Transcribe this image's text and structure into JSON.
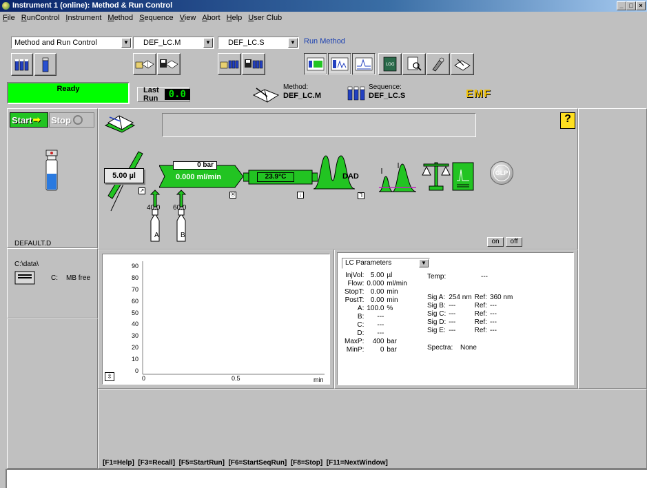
{
  "window": {
    "title": "Instrument 1 (online): Method & Run Control",
    "minimize": "_",
    "maximize": "□",
    "close": "×"
  },
  "menu": [
    "File",
    "RunControl",
    "Instrument",
    "Method",
    "Sequence",
    "View",
    "Abort",
    "Help",
    "User Club"
  ],
  "toolbar": {
    "view_select": "Method and Run Control",
    "method_select": "DEF_LC.M",
    "sequence_select": "DEF_LC.S",
    "run_method_link": "Run Method"
  },
  "status": {
    "state": "Ready",
    "state_color": "#00ff00",
    "last_run_label": "Last Run",
    "last_run_value": "0.0",
    "method_label": "Method:",
    "method_value": "DEF_LC.M",
    "sequence_label": "Sequence:",
    "sequence_value": "DEF_LC.S",
    "emf_label": "EMF"
  },
  "controls": {
    "start": "Start",
    "stop": "Stop",
    "help": "?"
  },
  "instrument": {
    "injector_volume": "5.00 µl",
    "pressure": "0 bar",
    "flow": "0.000 ml/min",
    "column_temp": "23.9°C",
    "detector": "DAD",
    "solvent_a_pct": "40.0",
    "solvent_b_pct": "60.0",
    "bottle_a": "A",
    "bottle_b": "B",
    "glp": "GLP",
    "on": "on",
    "off": "off"
  },
  "sample": {
    "data_file": "DEFAULT.D",
    "path": "C:\\data\\",
    "drive": "C:",
    "free": "MB free"
  },
  "plot": {
    "y_ticks": [
      "90",
      "80",
      "70",
      "60",
      "50",
      "40",
      "30",
      "20",
      "10",
      "0"
    ],
    "x_ticks": [
      "0",
      "0.5",
      "min"
    ]
  },
  "lc_params": {
    "select": "LC Parameters",
    "rows": [
      {
        "k": "InjVol:",
        "v": "5.00",
        "u": "µl"
      },
      {
        "k": "Flow:",
        "v": "0.000",
        "u": "ml/min"
      },
      {
        "k": "StopT:",
        "v": "0.00",
        "u": "min"
      },
      {
        "k": "PostT:",
        "v": "0.00",
        "u": "min"
      },
      {
        "k": "A:",
        "v": "100.0",
        "u": "%"
      },
      {
        "k": "B:",
        "v": "---",
        "u": ""
      },
      {
        "k": "C:",
        "v": "---",
        "u": ""
      },
      {
        "k": "D:",
        "v": "---",
        "u": ""
      },
      {
        "k": "MaxP:",
        "v": "400",
        "u": "bar"
      },
      {
        "k": "MinP:",
        "v": "0",
        "u": "bar"
      }
    ],
    "temp_label": "Temp:",
    "temp_value": "---",
    "signals": [
      {
        "k": "Sig A:",
        "v": "254 nm",
        "r": "Ref:",
        "rv": "360 nm"
      },
      {
        "k": "Sig B:",
        "v": "---",
        "r": "Ref:",
        "rv": "---"
      },
      {
        "k": "Sig C:",
        "v": "---",
        "r": "Ref:",
        "rv": "---"
      },
      {
        "k": "Sig D:",
        "v": "---",
        "r": "Ref:",
        "rv": "---"
      },
      {
        "k": "Sig E:",
        "v": "---",
        "r": "Ref:",
        "rv": "---"
      }
    ],
    "spectra_label": "Spectra:",
    "spectra_value": "None"
  },
  "hotkeys": "[F1=Help]  [F3=Recall]  [F5=StartRun]  [F6=StartSeqRun]  [F8=Stop]  [F11=NextWindow]"
}
